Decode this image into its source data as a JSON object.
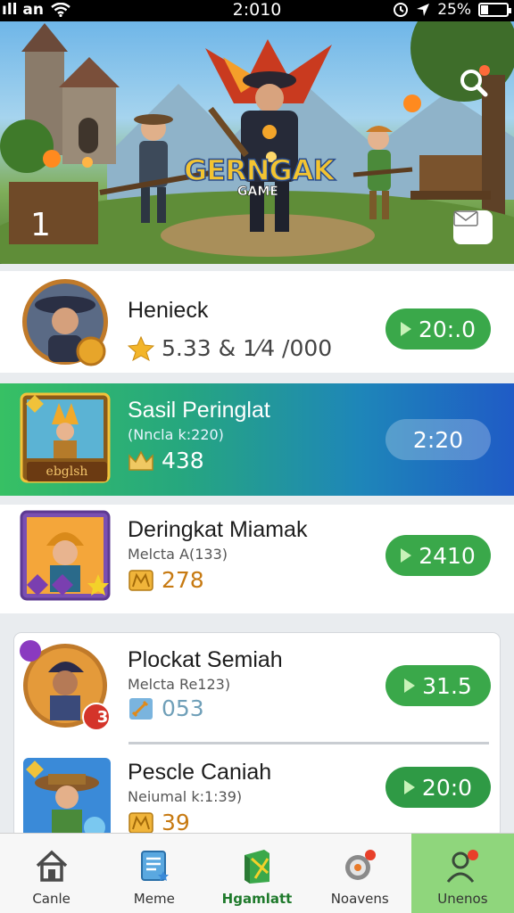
{
  "status_bar": {
    "carrier": "ıll an",
    "time": "2:010",
    "battery": "25%",
    "battery_level": 0.25
  },
  "banner": {
    "logo": "GERNGAK",
    "logo_sub": "GAME",
    "page_number": "1",
    "icons": {
      "search": "search-icon",
      "dropdown": "chevron-down-icon"
    }
  },
  "games": [
    {
      "name": "Henieck",
      "rating": "5.33",
      "stat_text": "& 1⁄4 /000",
      "button": "20:.0",
      "icon": "star-icon"
    },
    {
      "name": "Sasil Peringlat",
      "subtitle": "(Nncla k:220)",
      "stat": "438",
      "button": "2:20",
      "icon": "crown-icon",
      "badge": "ebglsh"
    },
    {
      "name": "Deringkat Miamak",
      "subtitle": "Melcta A(133)",
      "stat": "278",
      "button": "2410",
      "icon": "gold-block-icon"
    },
    {
      "name": "Plockat Semiah",
      "subtitle": "Melcta Re123)",
      "stat": "053",
      "button": "31.5",
      "icon": "sword-icon",
      "level_badge": "3"
    },
    {
      "name": "Pescle Caniah",
      "subtitle": "Neiumal k:1:39)",
      "stat": "39",
      "button": "20:0",
      "icon": "gold-block-icon"
    }
  ],
  "nav": [
    {
      "label": "Canle",
      "icon": "home-icon"
    },
    {
      "label": "Meme",
      "icon": "document-icon"
    },
    {
      "label": "Hgamlatt",
      "icon": "game-box-icon"
    },
    {
      "label": "Noavens",
      "icon": "target-icon"
    },
    {
      "label": "Unenos",
      "icon": "person-icon"
    }
  ],
  "colors": {
    "play_green": "#3aa84a",
    "highlight_start": "#37c064",
    "highlight_end": "#1f5bc6",
    "nav_active_bg": "#8fd67c"
  }
}
